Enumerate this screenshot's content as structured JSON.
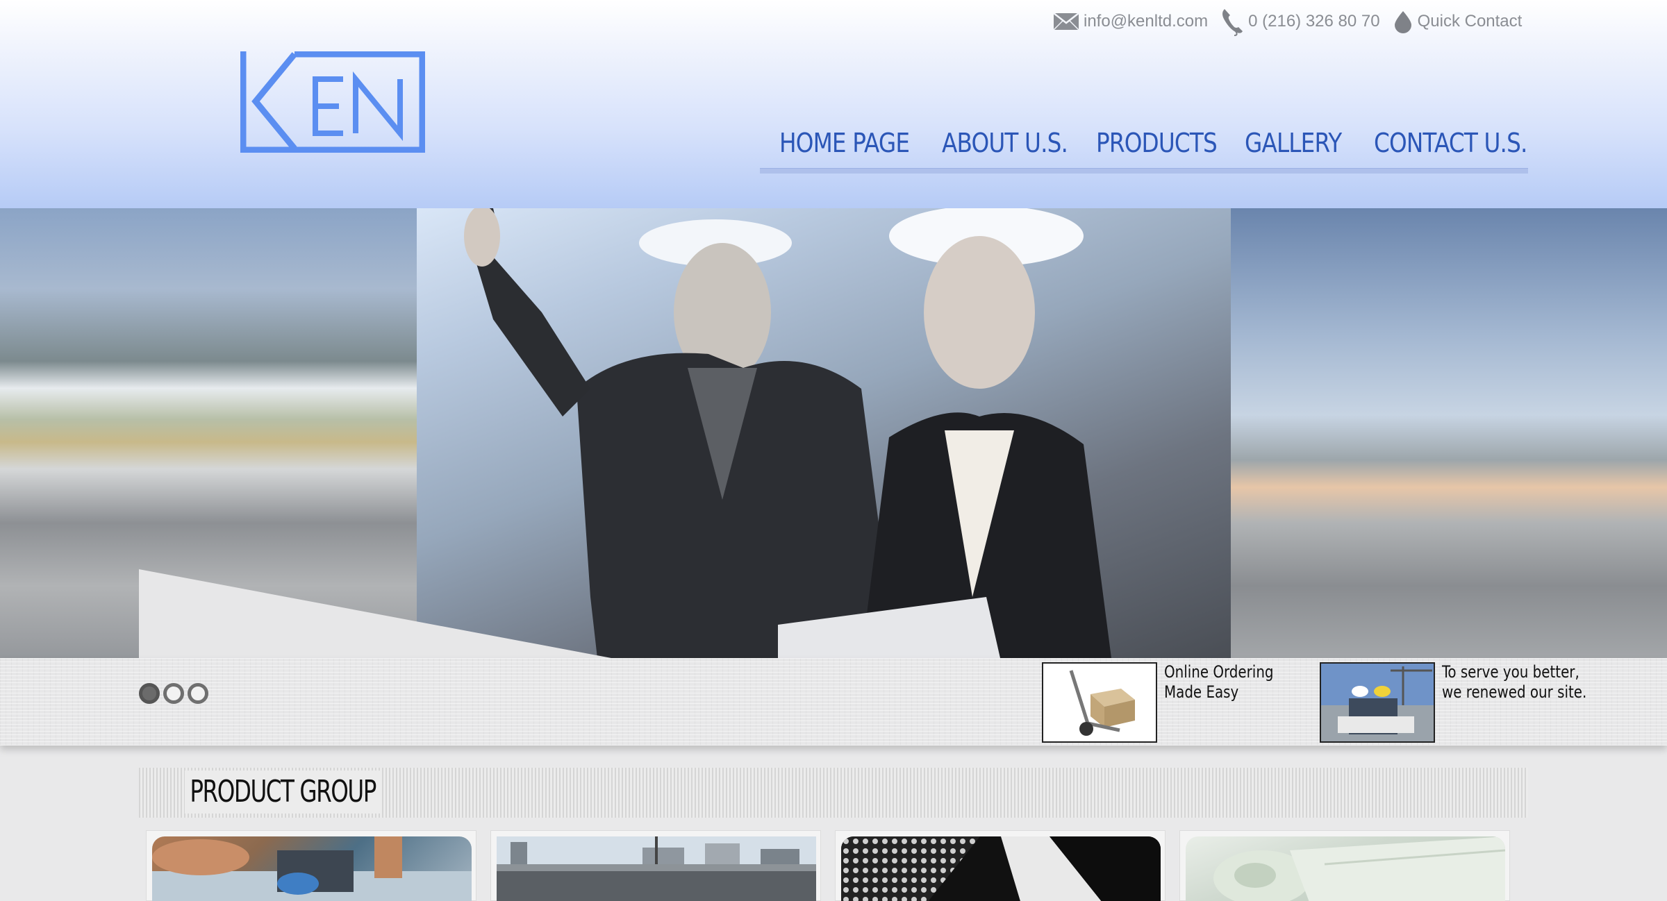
{
  "header": {
    "logo_text": "KEN",
    "email": "info@kenltd.com",
    "phone": "0 (216) 326 80 70",
    "quick_contact": "Quick Contact",
    "nav": [
      {
        "label": "HOME PAGE"
      },
      {
        "label": "ABOUT U.S."
      },
      {
        "label": "PRODUCTS"
      },
      {
        "label": "GALLERY"
      },
      {
        "label": "CONTACT U.S."
      }
    ]
  },
  "slider": {
    "slide_count": 3,
    "active_index": 0
  },
  "news": [
    {
      "text": "Online Ordering Made Easy",
      "icon": "hand-truck-icon"
    },
    {
      "text": "To serve you better, we renewed our site.",
      "icon": "engineers-photo-icon"
    }
  ],
  "products": {
    "heading": "PRODUCT GROUP",
    "items": [
      {
        "image": "roofing-worker-photo"
      },
      {
        "image": "building-construction-photo"
      },
      {
        "image": "perforated-metal-photo"
      },
      {
        "image": "membrane-roll-photo"
      }
    ]
  },
  "colors": {
    "brand_blue": "#2b56b7",
    "logo_blue": "#5b8ef1",
    "header_gradient_bottom": "#b6cbf6"
  }
}
